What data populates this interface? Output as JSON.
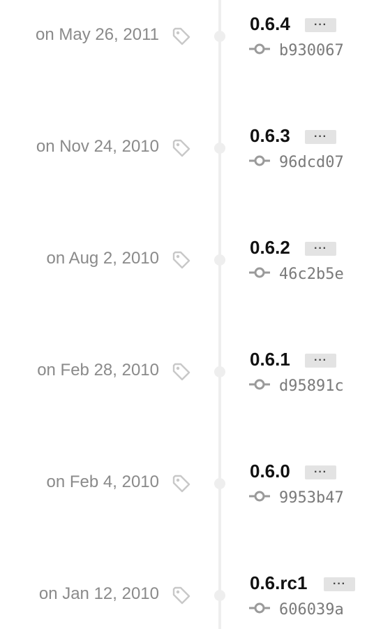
{
  "releases": [
    {
      "date": "on May 26, 2011",
      "version": "0.6.4",
      "menu_label": "···",
      "sha": "b930067"
    },
    {
      "date": "on Nov 24, 2010",
      "version": "0.6.3",
      "menu_label": "···",
      "sha": "96dcd07"
    },
    {
      "date": "on Aug 2, 2010",
      "version": "0.6.2",
      "menu_label": "···",
      "sha": "46c2b5e"
    },
    {
      "date": "on Feb 28, 2010",
      "version": "0.6.1",
      "menu_label": "···",
      "sha": "d95891c"
    },
    {
      "date": "on Feb 4, 2010",
      "version": "0.6.0",
      "menu_label": "···",
      "sha": "9953b47"
    },
    {
      "date": "on Jan 12, 2010",
      "version": "0.6.rc1",
      "menu_label": "···",
      "sha": "606039a"
    }
  ],
  "icons": {
    "tag": "tag-icon",
    "commit": "git-commit-icon"
  },
  "colors": {
    "line": "#eeeeee",
    "date_text": "#8a8a8a",
    "version_text": "#111111",
    "sha_text": "#7a7a7a"
  }
}
